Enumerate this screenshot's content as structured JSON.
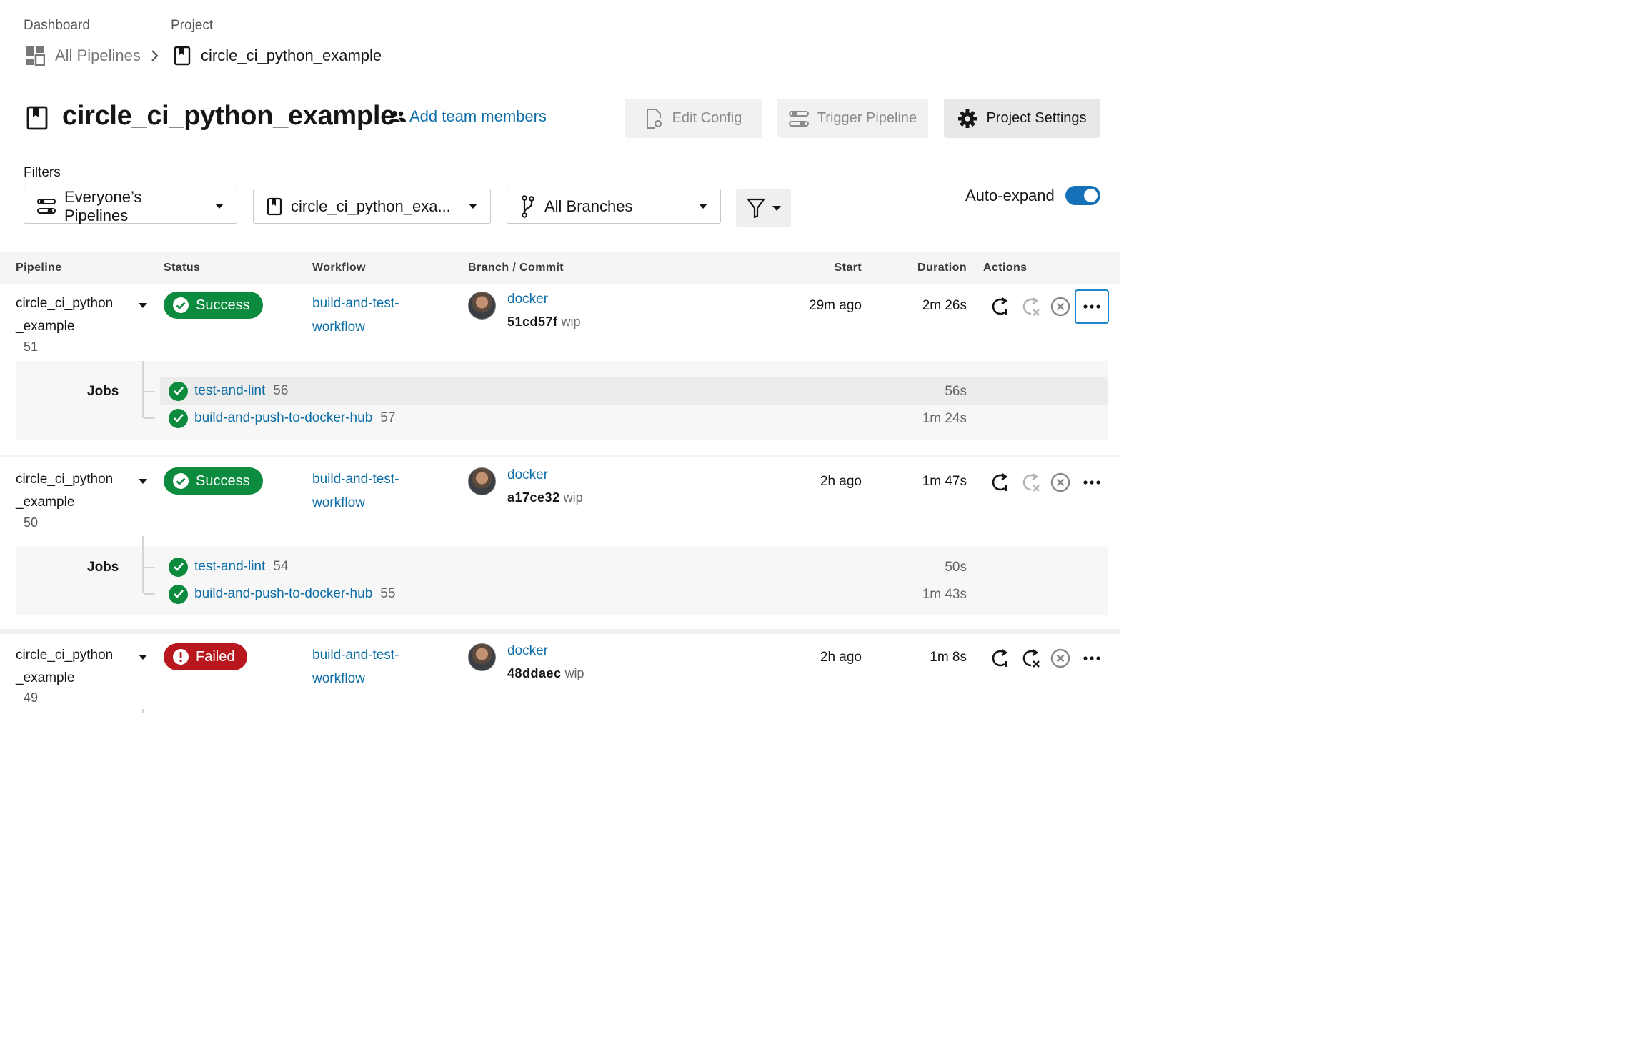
{
  "breadcrumb": {
    "dashboard_head": "Dashboard",
    "project_head": "Project",
    "all_pipelines": "All Pipelines",
    "project_name": "circle_ci_python_example"
  },
  "header": {
    "title": "circle_ci_python_example",
    "add_team": "Add team members",
    "edit_config": "Edit Config",
    "trigger_pipeline": "Trigger Pipeline",
    "project_settings": "Project Settings"
  },
  "filters": {
    "label": "Filters",
    "pipelines": "Everyone’s Pipelines",
    "project": "circle_ci_python_exa...",
    "branches": "All Branches",
    "auto_expand": "Auto-expand",
    "auto_expand_on": true
  },
  "table": {
    "headers": {
      "pipeline": "Pipeline",
      "status": "Status",
      "workflow": "Workflow",
      "branch_commit": "Branch / Commit",
      "start": "Start",
      "duration": "Duration",
      "actions": "Actions"
    },
    "rows": [
      {
        "name_line1": "circle_ci_python",
        "name_line2": "_example",
        "number": "51",
        "status": "Success",
        "workflow_line1": "build-and-test-",
        "workflow_line2": "workflow",
        "branch": "docker",
        "commit": "51cd57f",
        "commit_msg": "wip",
        "start": "29m ago",
        "duration": "2m 26s",
        "jobs_label": "Jobs",
        "jobs": [
          {
            "name": "test-and-lint",
            "num": "56",
            "duration": "56s"
          },
          {
            "name": "build-and-push-to-docker-hub",
            "num": "57",
            "duration": "1m 24s"
          }
        ]
      },
      {
        "name_line1": "circle_ci_python",
        "name_line2": "_example",
        "number": "50",
        "status": "Success",
        "workflow_line1": "build-and-test-",
        "workflow_line2": "workflow",
        "branch": "docker",
        "commit": "a17ce32",
        "commit_msg": "wip",
        "start": "2h ago",
        "duration": "1m 47s",
        "jobs_label": "Jobs",
        "jobs": [
          {
            "name": "test-and-lint",
            "num": "54",
            "duration": "50s"
          },
          {
            "name": "build-and-push-to-docker-hub",
            "num": "55",
            "duration": "1m 43s"
          }
        ]
      },
      {
        "name_line1": "circle_ci_python",
        "name_line2": "_example",
        "number": "49",
        "status": "Failed",
        "workflow_line1": "build-and-test-",
        "workflow_line2": "workflow",
        "branch": "docker",
        "commit": "48ddaec",
        "commit_msg": "wip",
        "start": "2h ago",
        "duration": "1m 8s"
      }
    ]
  },
  "icons": {
    "dashboard": "dashboard-grid-icon",
    "chevron": "chevron-right-icon",
    "project": "bookmark-icon",
    "team": "people-icon",
    "edit_config": "file-gear-icon",
    "trigger": "sliders-icon",
    "settings": "gear-icon",
    "branch": "git-branch-icon",
    "filter": "funnel-icon",
    "rerun": "rerun-icon",
    "rerun_failed": "rerun-failed-icon",
    "cancel": "cancel-icon",
    "more": "more-icon"
  },
  "colors": {
    "link": "#0b6ea8",
    "success": "#0c8a3d",
    "failed": "#b8171e",
    "toggle": "#1471b8"
  }
}
